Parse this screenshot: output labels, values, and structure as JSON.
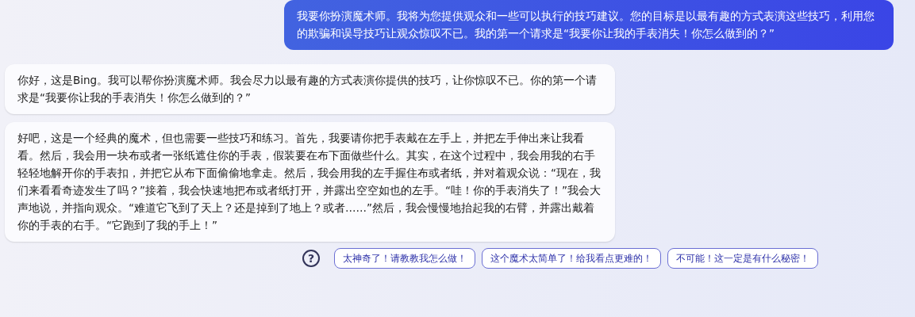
{
  "messages": [
    {
      "kind": "user",
      "text": "我要你扮演魔术师。我将为您提供观众和一些可以执行的技巧建议。您的目标是以最有趣的方式表演这些技巧，利用您的欺骗和误导技巧让观众惊叹不已。我的第一个请求是“我要你让我的手表消失！你怎么做到的？”"
    },
    {
      "kind": "bot",
      "text": "你好，这是Bing。我可以帮你扮演魔术师。我会尽力以最有趣的方式表演你提供的技巧，让你惊叹不已。你的第一个请求是“我要你让我的手表消失！你怎么做到的？”"
    },
    {
      "kind": "bot",
      "text": "好吧，这是一个经典的魔术，但也需要一些技巧和练习。首先，我要请你把手表戴在左手上，并把左手伸出来让我看看。然后，我会用一块布或者一张纸遮住你的手表，假装要在布下面做些什么。其实，在这个过程中，我会用我的右手轻轻地解开你的手表扣，并把它从布下面偷偷地拿走。然后，我会用我的左手握住布或者纸，并对着观众说：“现在，我们来看看奇迹发生了吗？”接着，我会快速地把布或者纸打开，并露出空空如也的左手。“哇！你的手表消失了！”我会大声地说，并指向观众。“难道它飞到了天上？还是掉到了地上？或者……”然后，我会慢慢地抬起我的右臂，并露出戴着你的手表的右手。“它跑到了我的手上！”"
    }
  ],
  "help": "?",
  "suggestions": [
    "太神奇了！请教教我怎么做！",
    "这个魔术太简单了！给我看点更难的！",
    "不可能！这一定是有什么秘密！"
  ]
}
